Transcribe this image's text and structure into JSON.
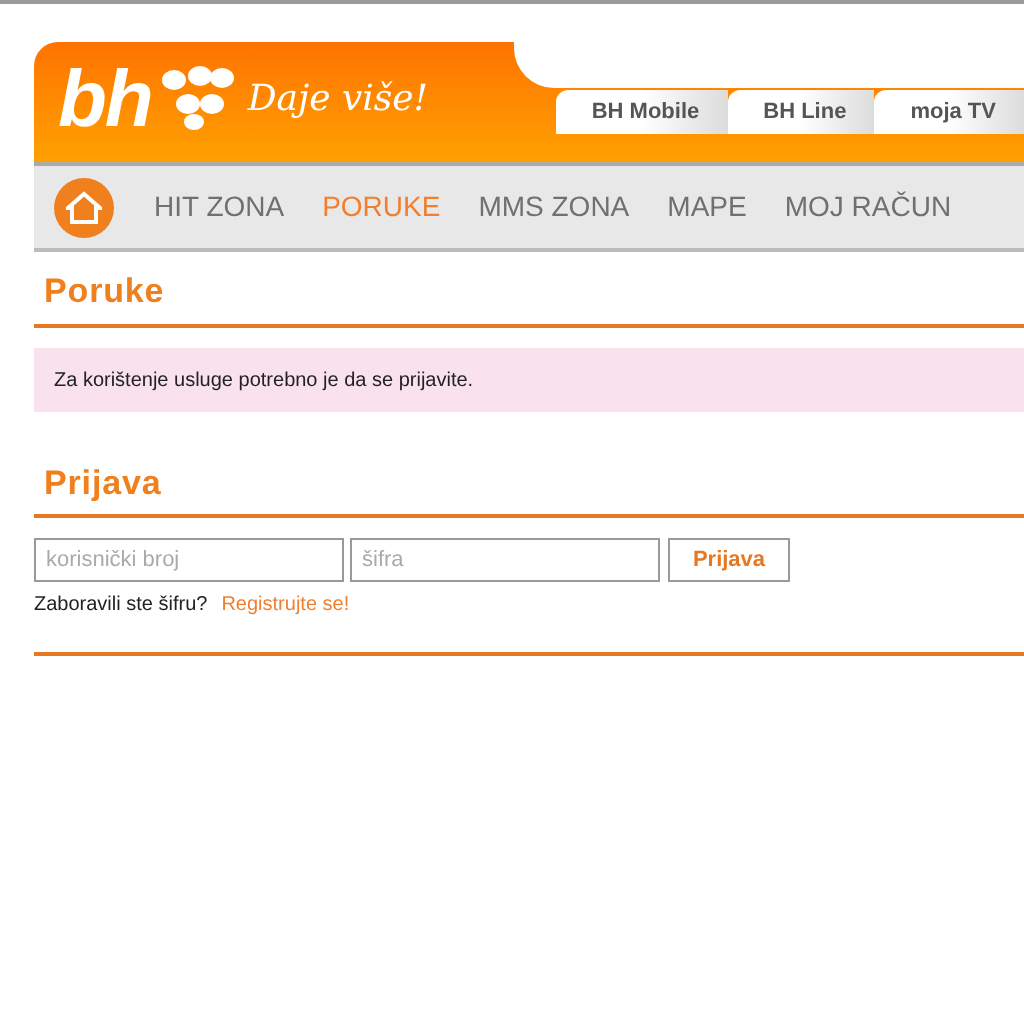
{
  "logo": {
    "text": "bh",
    "slogan": "Daje više!"
  },
  "top_tabs": [
    {
      "label": "BH Mobile"
    },
    {
      "label": "BH Line"
    },
    {
      "label": "moja TV"
    }
  ],
  "nav": [
    {
      "label": "HIT ZONA",
      "selected": false
    },
    {
      "label": "PORUKE",
      "selected": true
    },
    {
      "label": "MMS ZONA",
      "selected": false
    },
    {
      "label": "MAPE",
      "selected": false
    },
    {
      "label": "MOJ RAČUN",
      "selected": false
    }
  ],
  "messages_section": {
    "title": "Poruke",
    "notice": "Za korištenje usluge potrebno je da se prijavite."
  },
  "login_section": {
    "title": "Prijava",
    "username": {
      "placeholder": "korisnički broj"
    },
    "password": {
      "placeholder": "šifra"
    },
    "submit": "Prijava",
    "forgot_text": "Zaboravili ste šifru?",
    "register_link": "Registrujte se!"
  }
}
